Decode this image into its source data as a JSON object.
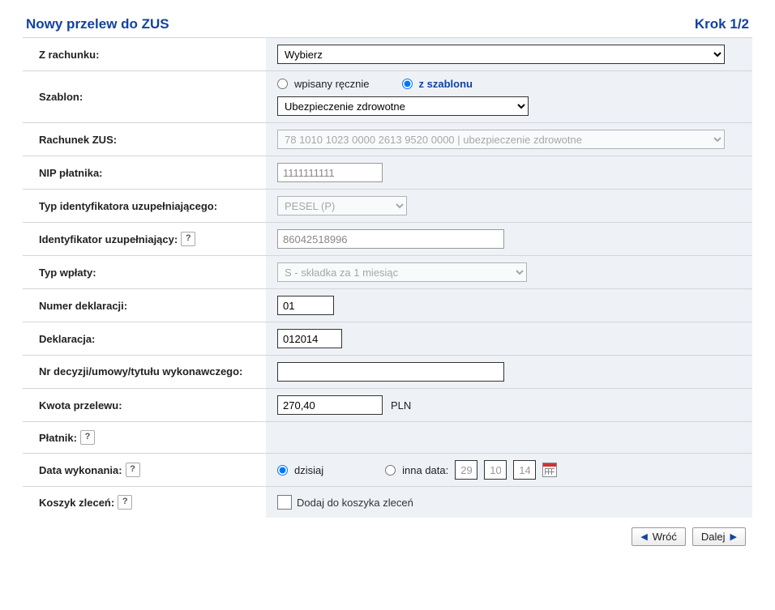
{
  "header": {
    "title": "Nowy przelew do ZUS",
    "step": "Krok 1/2"
  },
  "labels": {
    "z_rachunku": "Z rachunku:",
    "szablon": "Szablon:",
    "rachunek_zus": "Rachunek ZUS:",
    "nip_platnika": "NIP płatnika:",
    "typ_id_uzup": "Typ identyfikatora uzupełniającego:",
    "id_uzup": "Identyfikator uzupełniający:",
    "typ_wplaty": "Typ wpłaty:",
    "numer_deklaracji": "Numer deklaracji:",
    "deklaracja": "Deklaracja:",
    "nr_decyzji": "Nr decyzji/umowy/tytułu wykonawczego:",
    "kwota": "Kwota przelewu:",
    "platnik": "Płatnik:",
    "data_wykonania": "Data wykonania:",
    "koszyk": "Koszyk zleceń:"
  },
  "fields": {
    "z_rachunku_value": "Wybierz",
    "szablon_radio_manual": "wpisany ręcznie",
    "szablon_radio_template": "z szablonu",
    "szablon_select": "Ubezpieczenie zdrowotne",
    "rachunek_zus_value": "78 1010 1023 0000 2613 9520 0000 | ubezpieczenie zdrowotne",
    "nip_value": "1111111111",
    "typ_id_value": "PESEL (P)",
    "id_uzup_value": "86042518996",
    "typ_wplaty_value": "S - składka za 1 miesiąc",
    "numer_dekl_value": "01",
    "deklaracja_value": "012014",
    "nr_decyzji_value": "",
    "kwota_value": "270,40",
    "currency": "PLN",
    "date_today": "dzisiaj",
    "date_other": "inna data:",
    "date_d": "29",
    "date_m": "10",
    "date_y": "14",
    "koszyk_label": "Dodaj do koszyka zleceń"
  },
  "footer": {
    "back": "Wróć",
    "next": "Dalej"
  },
  "help": "?"
}
